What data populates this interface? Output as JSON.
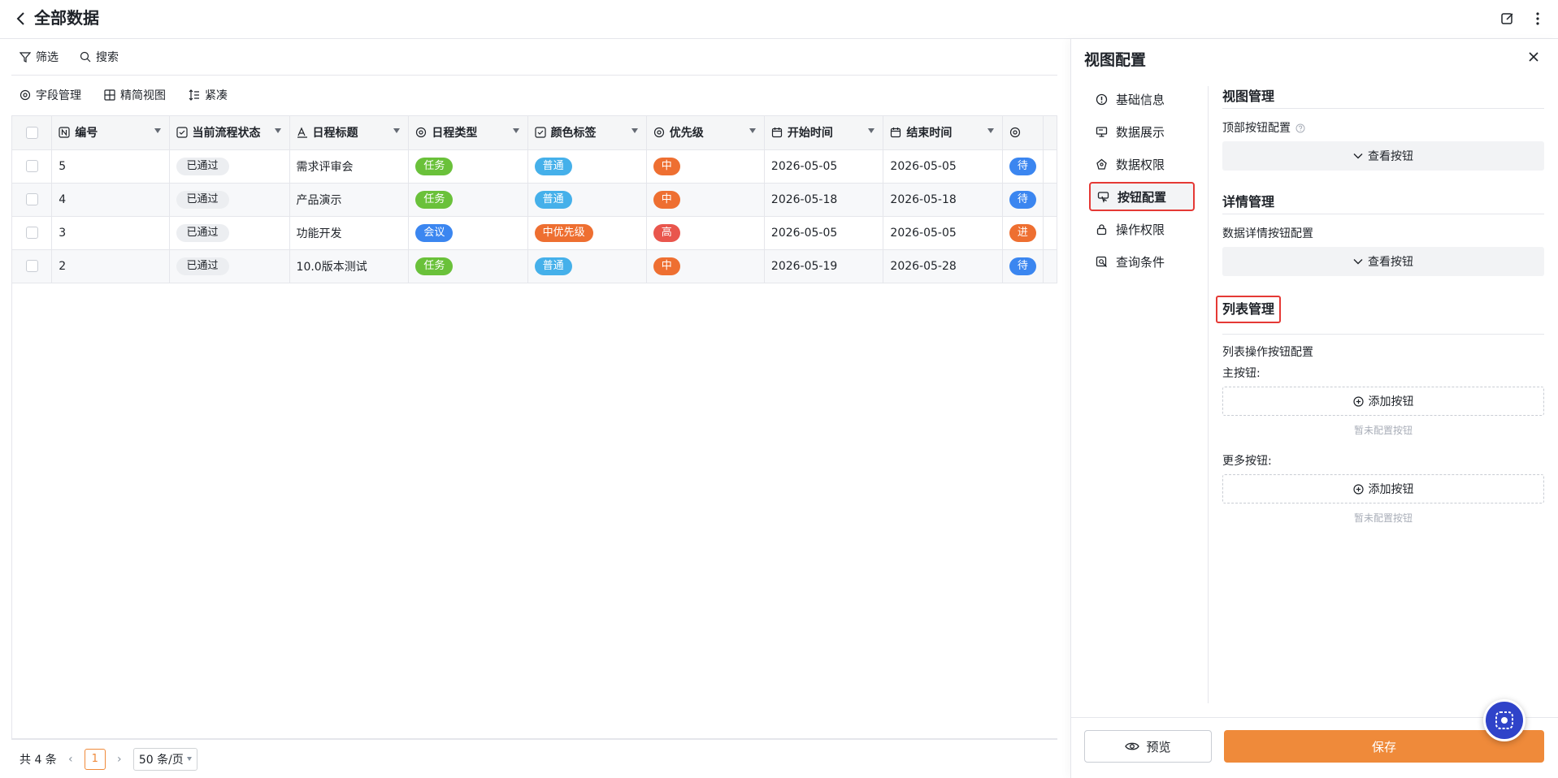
{
  "header": {
    "title": "全部数据"
  },
  "toolbar": {
    "filter": "筛选",
    "search": "搜索",
    "fields": "字段管理",
    "simple_view": "精简视图",
    "compact": "紧凑"
  },
  "table": {
    "columns": [
      "编号",
      "当前流程状态",
      "日程标题",
      "日程类型",
      "颜色标签",
      "优先级",
      "开始时间",
      "结束时间"
    ],
    "rows": [
      {
        "id": "5",
        "status": "已通过",
        "title": "需求评审会",
        "type": "任务",
        "color_tag": "普通",
        "priority": "中",
        "start": "2026-05-05",
        "end": "2026-05-05",
        "extra": "待"
      },
      {
        "id": "4",
        "status": "已通过",
        "title": "产品演示",
        "type": "任务",
        "color_tag": "普通",
        "priority": "中",
        "start": "2026-05-18",
        "end": "2026-05-18",
        "extra": "待"
      },
      {
        "id": "3",
        "status": "已通过",
        "title": "功能开发",
        "type": "会议",
        "color_tag": "中优先级",
        "priority": "高",
        "start": "2026-05-05",
        "end": "2026-05-05",
        "extra": "进"
      },
      {
        "id": "2",
        "status": "已通过",
        "title": "10.0版本测试",
        "type": "任务",
        "color_tag": "普通",
        "priority": "中",
        "start": "2026-05-19",
        "end": "2026-05-28",
        "extra": "待"
      }
    ]
  },
  "pager": {
    "total": "共 4 条",
    "page": "1",
    "page_size": "50 条/页"
  },
  "drawer": {
    "title": "视图配置",
    "nav": [
      "基础信息",
      "数据展示",
      "数据权限",
      "按钮配置",
      "操作权限",
      "查询条件"
    ],
    "sections": {
      "view": {
        "title": "视图管理",
        "label": "顶部按钮配置",
        "button": "查看按钮"
      },
      "detail": {
        "title": "详情管理",
        "label": "数据详情按钮配置",
        "button": "查看按钮"
      },
      "list": {
        "title": "列表管理",
        "label": "列表操作按钮配置",
        "main_label": "主按钮:",
        "more_label": "更多按钮:",
        "add": "添加按钮",
        "empty": "暂未配置按钮"
      }
    },
    "footer": {
      "preview": "预览",
      "save": "保存"
    }
  },
  "colors": {
    "accent": "#ef8a3a",
    "green": "#6ac13a",
    "blue": "#3b86f0",
    "sky": "#45b0ea",
    "orange": "#ee6f31",
    "red": "#e9564d",
    "highlight": "#e53935"
  }
}
